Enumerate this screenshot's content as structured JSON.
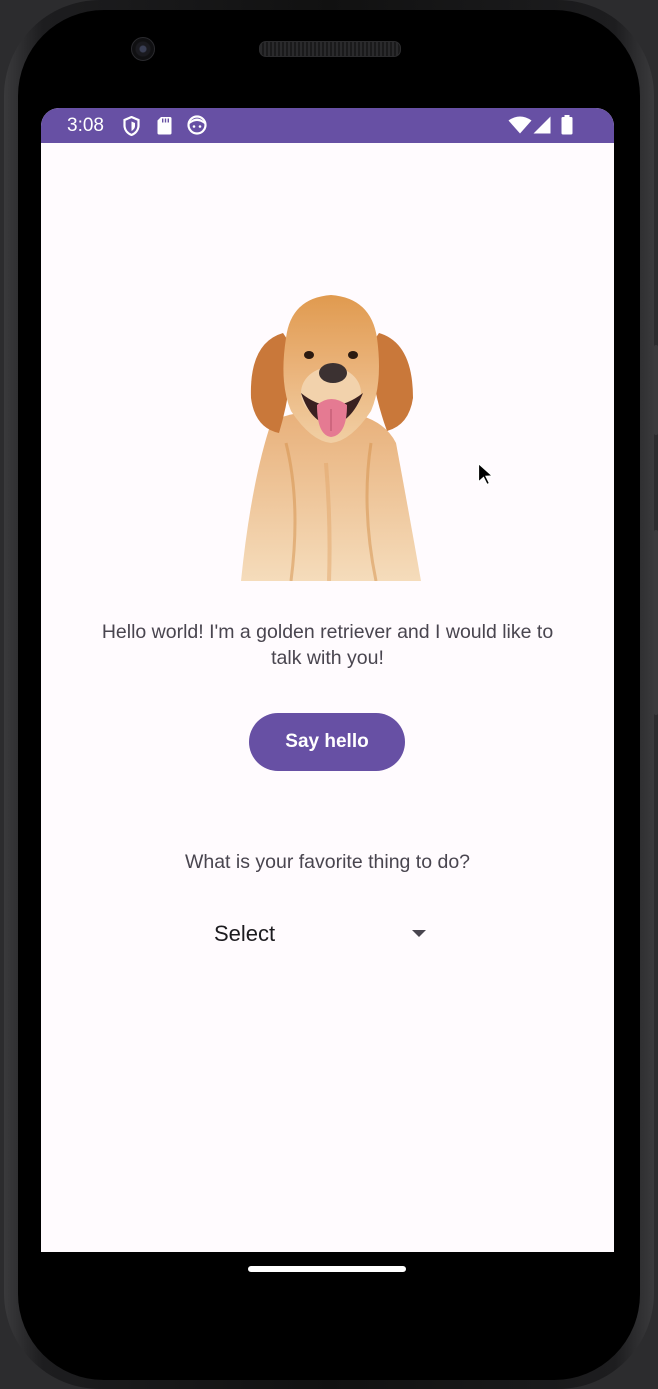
{
  "status_bar": {
    "time": "3:08",
    "left_icons": [
      "shield-icon",
      "sd-card-icon",
      "face-icon"
    ],
    "right_icons": [
      "wifi-icon",
      "cell-signal-icon",
      "battery-icon"
    ],
    "background_color": "#6750a4"
  },
  "main": {
    "image_icon": "golden-retriever-photo",
    "intro_text": "Hello world! I'm a golden retriever and I would like to talk with you!",
    "say_hello_label": "Say hello",
    "question": "What is your favorite thing to do?",
    "select_value": "Select"
  },
  "colors": {
    "primary": "#6750a4",
    "background": "#fffbfe",
    "text_secondary": "#49454f"
  }
}
